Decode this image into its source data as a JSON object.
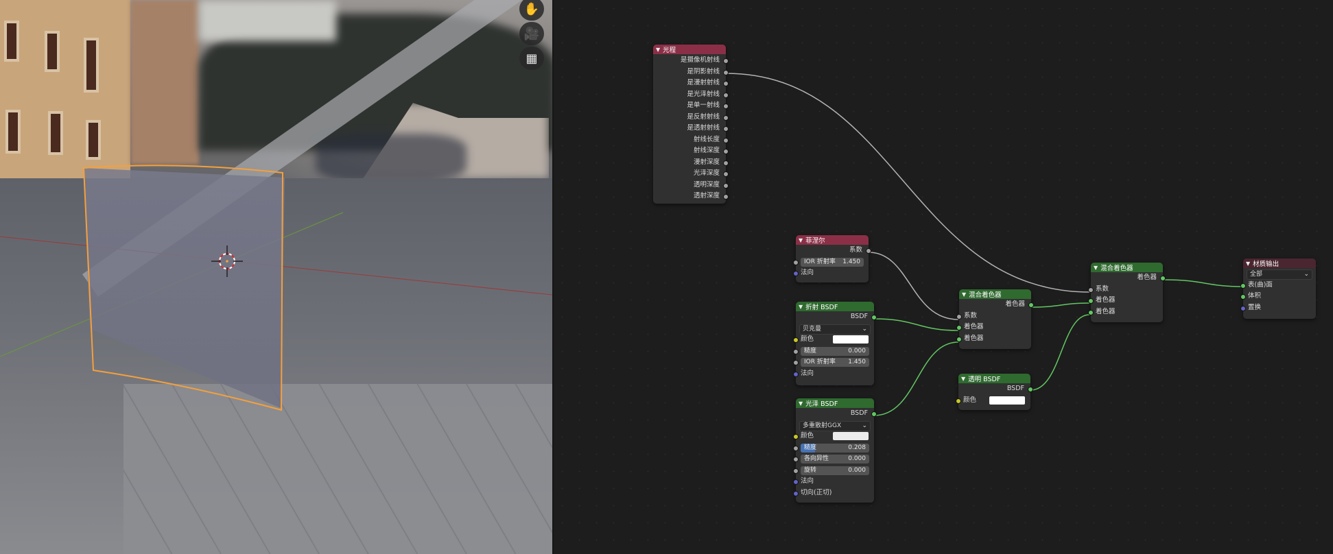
{
  "viewport": {
    "tools": [
      {
        "name": "hand-icon",
        "glyph": "✋"
      },
      {
        "name": "camera-icon",
        "glyph": "🎥"
      },
      {
        "name": "grid-view-icon",
        "glyph": "▦"
      }
    ],
    "selection_color": "#f5a03c",
    "background_hint": "blurred city street HDRI"
  },
  "nodes": {
    "light_path": {
      "title": "光程",
      "outputs": [
        "是摄像机射线",
        "是阴影射线",
        "是漫射射线",
        "是光泽射线",
        "是单一射线",
        "是反射射线",
        "是透射射线",
        "射线长度",
        "射线深度",
        "漫射深度",
        "光泽深度",
        "透明深度",
        "透射深度"
      ]
    },
    "fresnel": {
      "title": "菲涅尔",
      "output": "系数",
      "ior_label": "IOR 折射率",
      "ior_value": "1.450",
      "normal_label": "法向"
    },
    "refraction": {
      "title": "折射 BSDF",
      "output": "BSDF",
      "distribution": "贝克曼",
      "color_label": "颜色",
      "color": "#ffffff",
      "roughness_label": "糙度",
      "roughness_value": "0.000",
      "ior_label": "IOR 折射率",
      "ior_value": "1.450",
      "normal_label": "法向"
    },
    "glossy": {
      "title": "光泽 BSDF",
      "output": "BSDF",
      "distribution": "多重散射GGX",
      "color_label": "颜色",
      "color": "#ededed",
      "roughness_label": "糙度",
      "roughness_value": "0.208",
      "roughness_fraction": 0.208,
      "anisotropy_label": "各向异性",
      "anisotropy_value": "0.000",
      "rotation_label": "旋转",
      "rotation_value": "0.000",
      "normal_label": "法向",
      "tangent_label": "切向(正切)"
    },
    "mix1": {
      "title": "混合着色器",
      "output": "着色器",
      "inputs": [
        "系数",
        "着色器",
        "着色器"
      ]
    },
    "transparent": {
      "title": "透明 BSDF",
      "output": "BSDF",
      "color_label": "颜色",
      "color": "#ffffff"
    },
    "mix2": {
      "title": "混合着色器",
      "output": "着色器",
      "inputs": [
        "系数",
        "着色器",
        "着色器"
      ]
    },
    "output": {
      "title": "材质输出",
      "target": "全部",
      "inputs": [
        "表(曲)面",
        "体积",
        "置换"
      ]
    }
  },
  "colors": {
    "header_input": "#8b2f47",
    "header_shader": "#2f6a2f",
    "header_output": "#4a2630",
    "link_grey": "#b4b4b4",
    "link_green": "#63c763"
  }
}
